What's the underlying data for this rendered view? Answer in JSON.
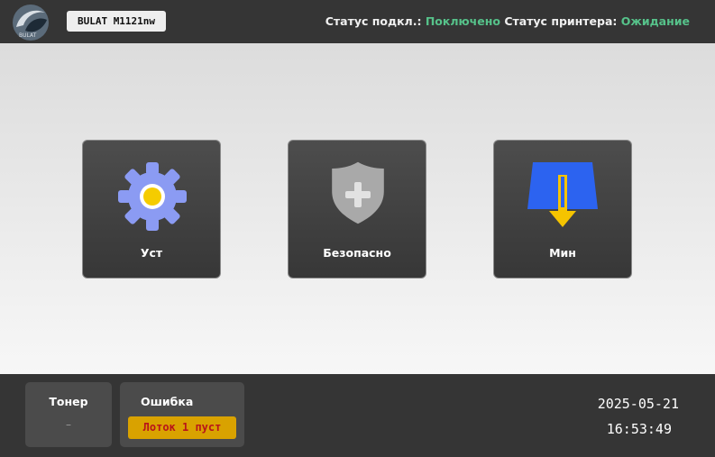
{
  "header": {
    "model": "BULAT M1121nw",
    "connection_label": "Статус подкл.:",
    "connection_value": "Поключено",
    "printer_label": "Статус принтера:",
    "printer_value": "Ожидание"
  },
  "tiles": [
    {
      "label": "Уст",
      "icon": "gear-icon"
    },
    {
      "label": "Безопасно",
      "icon": "shield-plus-icon"
    },
    {
      "label": "Мин",
      "icon": "paper-tray-download-icon"
    }
  ],
  "footer": {
    "toner_title": "Тонер",
    "toner_value": "–",
    "error_title": "Ошибка",
    "error_message": "Лоток 1 пуст",
    "date": "2025-05-21",
    "time": "16:53:49"
  },
  "colors": {
    "ok_green": "#56c28a",
    "gear_blue": "#8b9bf3",
    "gear_center": "#f5cc00",
    "tray_blue": "#2c63f0",
    "arrow_yellow": "#f5c400",
    "error_bg": "#d9a200",
    "error_text": "#b8141a"
  }
}
